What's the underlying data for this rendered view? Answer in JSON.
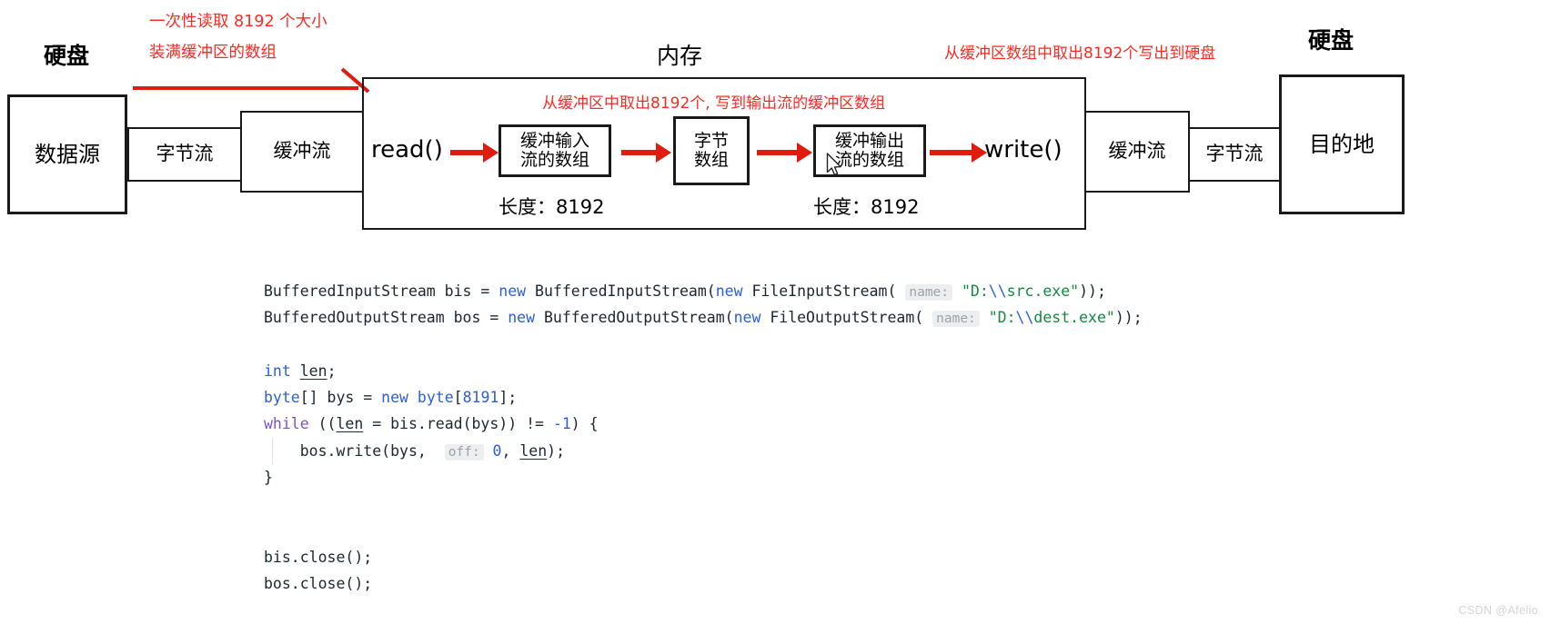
{
  "diagram": {
    "title_left_disk": "硬盘",
    "title_memory": "内存",
    "title_right_disk": "硬盘",
    "annotations": {
      "read_note_line1": "一次性读取 8192 个大小",
      "read_note_line2": "装满缓冲区的数组",
      "middle_note": "从缓冲区中取出8192个, 写到输出流的缓冲区数组",
      "write_note": "从缓冲区数组中取出8192个写出到硬盘"
    },
    "nodes": {
      "source": "数据源",
      "byte_stream_left": "字节流",
      "buffered_stream_left": "缓冲流",
      "read_call": "read()",
      "buffered_input_array_l1": "缓冲输入",
      "buffered_input_array_l2": "流的数组",
      "buffered_input_length": "长度：8192",
      "byte_array_l1": "字节",
      "byte_array_l2": "数组",
      "buffered_output_array_l1": "缓冲输出",
      "buffered_output_array_l2": "流的数组",
      "buffered_output_length": "长度：8192",
      "write_call": "write()",
      "buffered_stream_right": "缓冲流",
      "byte_stream_right": "字节流",
      "destination": "目的地"
    },
    "colors": {
      "annotation_red": "#ff2a22",
      "arrow_red": "#e01b10",
      "box_border": "#1a1a1a"
    }
  },
  "code": {
    "lines": [
      {
        "id": "line-1",
        "tokens": [
          {
            "t": "BufferedInputStream bis = ",
            "c": "plain"
          },
          {
            "t": "new",
            "c": "kw"
          },
          {
            "t": " BufferedInputStream(",
            "c": "plain"
          },
          {
            "t": "new",
            "c": "kw"
          },
          {
            "t": " FileInputStream(",
            "c": "plain"
          },
          {
            "t": " ",
            "c": "plain"
          },
          {
            "t": "name:",
            "c": "hint"
          },
          {
            "t": " ",
            "c": "plain"
          },
          {
            "t": "\"D:",
            "c": "str"
          },
          {
            "t": "\\\\",
            "c": "esc"
          },
          {
            "t": "src.exe\"",
            "c": "str"
          },
          {
            "t": "));",
            "c": "plain"
          }
        ]
      },
      {
        "id": "line-2",
        "tokens": [
          {
            "t": "BufferedOutputStream bos = ",
            "c": "plain"
          },
          {
            "t": "new",
            "c": "kw"
          },
          {
            "t": " BufferedOutputStream(",
            "c": "plain"
          },
          {
            "t": "new",
            "c": "kw"
          },
          {
            "t": " FileOutputStream(",
            "c": "plain"
          },
          {
            "t": " ",
            "c": "plain"
          },
          {
            "t": "name:",
            "c": "hint"
          },
          {
            "t": " ",
            "c": "plain"
          },
          {
            "t": "\"D:",
            "c": "str"
          },
          {
            "t": "\\\\",
            "c": "esc"
          },
          {
            "t": "dest.exe\"",
            "c": "str"
          },
          {
            "t": "));",
            "c": "plain"
          }
        ]
      },
      {
        "id": "line-3",
        "tokens": []
      },
      {
        "id": "line-4",
        "tokens": [
          {
            "t": "int",
            "c": "kw"
          },
          {
            "t": " ",
            "c": "plain"
          },
          {
            "t": "len",
            "c": "und"
          },
          {
            "t": ";",
            "c": "plain"
          }
        ]
      },
      {
        "id": "line-5",
        "tokens": [
          {
            "t": "byte",
            "c": "kw"
          },
          {
            "t": "[] bys = ",
            "c": "plain"
          },
          {
            "t": "new",
            "c": "kw"
          },
          {
            "t": " ",
            "c": "plain"
          },
          {
            "t": "byte",
            "c": "kw"
          },
          {
            "t": "[",
            "c": "plain"
          },
          {
            "t": "8191",
            "c": "num"
          },
          {
            "t": "];",
            "c": "plain"
          }
        ]
      },
      {
        "id": "line-6",
        "tokens": [
          {
            "t": "while",
            "c": "kw2"
          },
          {
            "t": " ((",
            "c": "plain"
          },
          {
            "t": "len",
            "c": "und"
          },
          {
            "t": " = bis.read(bys)) != ",
            "c": "plain"
          },
          {
            "t": "-1",
            "c": "num"
          },
          {
            "t": ") {",
            "c": "plain"
          }
        ]
      },
      {
        "id": "line-7",
        "guide": true,
        "tokens": [
          {
            "t": "    bos.write(bys, ",
            "c": "plain"
          },
          {
            "t": " ",
            "c": "plain"
          },
          {
            "t": "off:",
            "c": "hint"
          },
          {
            "t": " ",
            "c": "plain"
          },
          {
            "t": "0",
            "c": "num"
          },
          {
            "t": ", ",
            "c": "plain"
          },
          {
            "t": "len",
            "c": "und"
          },
          {
            "t": ");",
            "c": "plain"
          }
        ]
      },
      {
        "id": "line-8",
        "tokens": [
          {
            "t": "}",
            "c": "plain"
          }
        ]
      },
      {
        "id": "line-9",
        "tokens": []
      },
      {
        "id": "line-10",
        "tokens": []
      },
      {
        "id": "line-11",
        "tokens": [
          {
            "t": "bis.close();",
            "c": "plain"
          }
        ]
      },
      {
        "id": "line-12",
        "tokens": [
          {
            "t": "bos.close();",
            "c": "plain"
          }
        ]
      }
    ]
  },
  "watermark": "CSDN @Afelio"
}
